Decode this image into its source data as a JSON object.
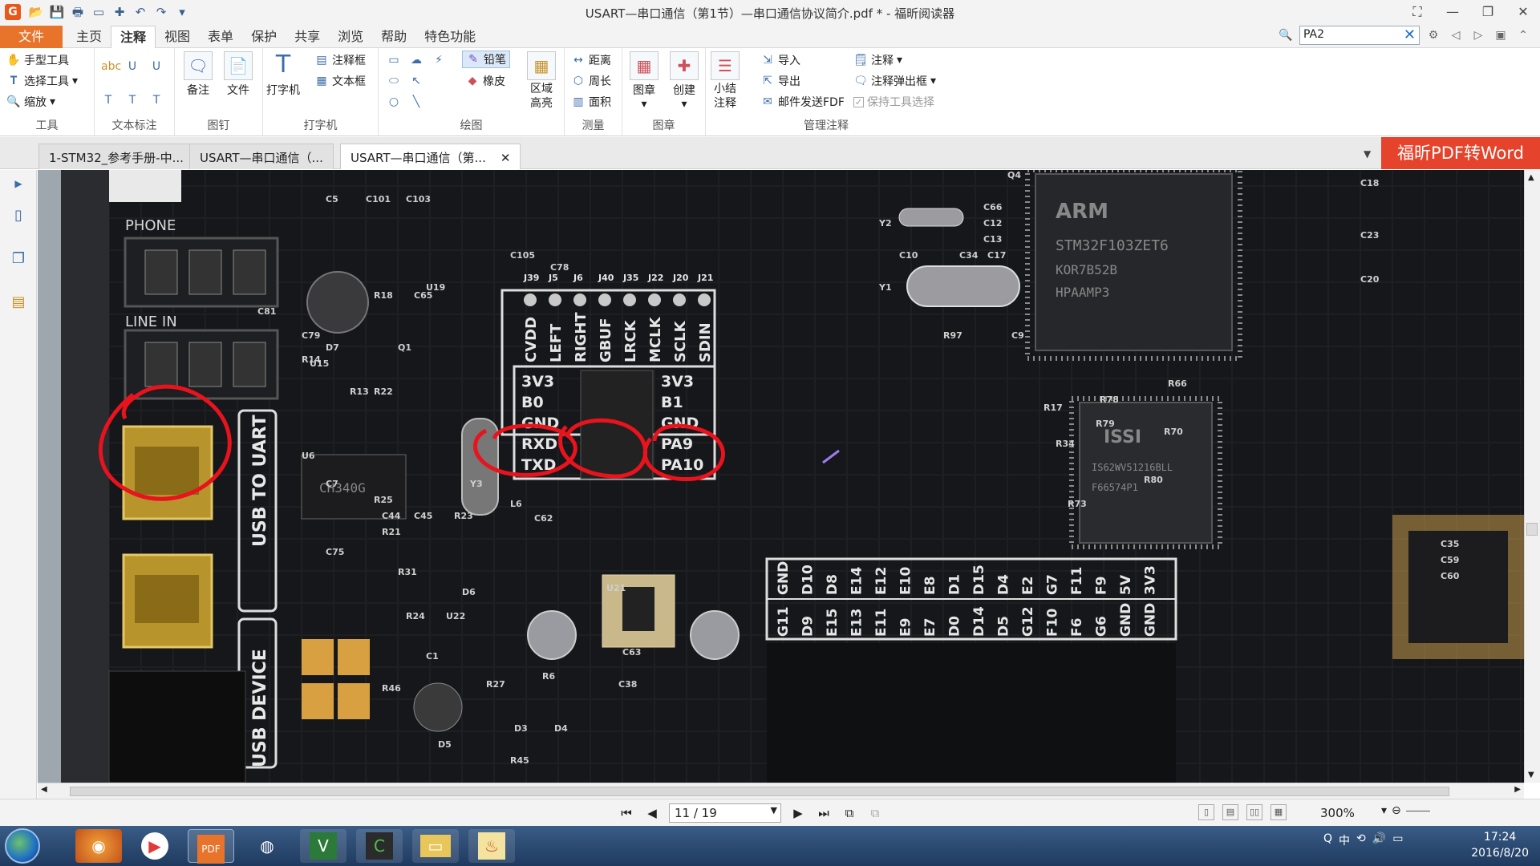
{
  "app": {
    "title": "USART—串口通信（第1节）—串口通信协议简介.pdf * - 福昕阅读器",
    "logo": "G"
  },
  "quick_access": [
    "open-icon",
    "save-icon",
    "print-icon",
    "print-preview-icon",
    "new-icon",
    "undo-icon",
    "redo-icon",
    "customize-icon"
  ],
  "menu": {
    "file": "文件",
    "tabs": [
      "主页",
      "注释",
      "视图",
      "表单",
      "保护",
      "共享",
      "浏览",
      "帮助",
      "特色功能"
    ],
    "active_tab": "注释"
  },
  "search": {
    "value": "PA2"
  },
  "ribbon": {
    "tools": {
      "hand": "手型工具",
      "select": "选择工具",
      "zoom": "缩放",
      "label": "工具"
    },
    "text_markup": {
      "label": "文本标注"
    },
    "pin": {
      "note": "备注",
      "file": "文件",
      "label": "图钉"
    },
    "typewriter": {
      "typewriter": "打字机",
      "callout": "注释框",
      "textbox": "文本框",
      "label": "打字机"
    },
    "drawing": {
      "pencil": "铅笔",
      "eraser": "橡皮",
      "area_highlight": "区域高亮",
      "label": "绘图"
    },
    "measure": {
      "distance": "距离",
      "perimeter": "周长",
      "area": "面积",
      "label": "测量"
    },
    "stamp": {
      "stamp": "图章",
      "create": "创建",
      "label": "图章"
    },
    "manage": {
      "summarize": "小结注释",
      "import": "导入",
      "export": "导出",
      "email_fdf": "邮件发送FDF",
      "comments": "注释",
      "popup": "注释弹出框",
      "keep_tool": "保持工具选择",
      "label": "管理注释"
    }
  },
  "doc_tabs": [
    {
      "label": "1-STM32_参考手册-中...",
      "active": false
    },
    {
      "label": "USART—串口通信（...",
      "active": false
    },
    {
      "label": "USART—串口通信（第...",
      "active": true
    }
  ],
  "promo": "福昕PDF转Word",
  "pcb": {
    "phone": "PHONE",
    "line_in": "LINE IN",
    "usb_to_uart": "USB TO UART",
    "usb_device": "USB DEVICE",
    "header_top": [
      "CVDD",
      "LEFT",
      "RIGHT",
      "GBUF",
      "LRCK",
      "MCLK",
      "SCLK",
      "SDIN"
    ],
    "header_top_ids": [
      "J39",
      "J5",
      "J6",
      "J40",
      "J35",
      "J22",
      "J20",
      "J21"
    ],
    "jumper_left": [
      "3V3",
      "B0",
      "GND",
      "RXD",
      "TXD"
    ],
    "jumper_right": [
      "3V3",
      "B1",
      "GND",
      "PA9",
      "PA10"
    ],
    "bottom_row1": [
      "GND",
      "D10",
      "D8",
      "E14",
      "E12",
      "E10",
      "E8",
      "D1",
      "D15",
      "D4",
      "E2",
      "G7",
      "F11",
      "F9",
      "5V",
      "3V3"
    ],
    "bottom_row2": [
      "G11",
      "D9",
      "E15",
      "E13",
      "E11",
      "E9",
      "E7",
      "D0",
      "D14",
      "D5",
      "G12",
      "F10",
      "F6",
      "G6",
      "GND",
      "GND"
    ],
    "chip_main": [
      "ARM",
      "STM32F103ZET6",
      "KOR7B52B",
      "HPAAMP3"
    ],
    "chip_sram": [
      "ISSI",
      "IS62WV51216BLL",
      "F66574P1"
    ],
    "chip_small": "CH340G",
    "labels": [
      "C18",
      "C23",
      "C20",
      "Y1",
      "Y2",
      "Q4",
      "R97",
      "C9",
      "C10",
      "C34",
      "C17",
      "U19",
      "C105",
      "C78",
      "U15",
      "R18",
      "C65",
      "C81",
      "C79",
      "D7",
      "R14",
      "Q1",
      "R13",
      "R22",
      "U6",
      "C7",
      "Y3",
      "R25",
      "C44",
      "R21",
      "C45",
      "R23",
      "R24",
      "U22",
      "L6",
      "C62",
      "C63",
      "U21",
      "C38",
      "C1",
      "R46",
      "D5",
      "D3",
      "D4",
      "R45",
      "R27",
      "R78",
      "R79",
      "R17",
      "R34",
      "R73",
      "R66",
      "R70",
      "R80",
      "C5",
      "C101",
      "C103",
      "C66",
      "C12",
      "C13",
      "C35",
      "C59",
      "C60",
      "R31",
      "D6",
      "R6",
      "C75"
    ]
  },
  "status": {
    "page": "11 / 19",
    "zoom": "300%"
  },
  "taskbar": {
    "time": "17:24",
    "date": "2016/8/20",
    "apps": [
      "firefox-icon",
      "media-player-icon",
      "pdf-icon",
      "network-icon",
      "v5-icon",
      "word-icon",
      "folder-icon",
      "fire-icon"
    ],
    "ime_label": "中"
  }
}
